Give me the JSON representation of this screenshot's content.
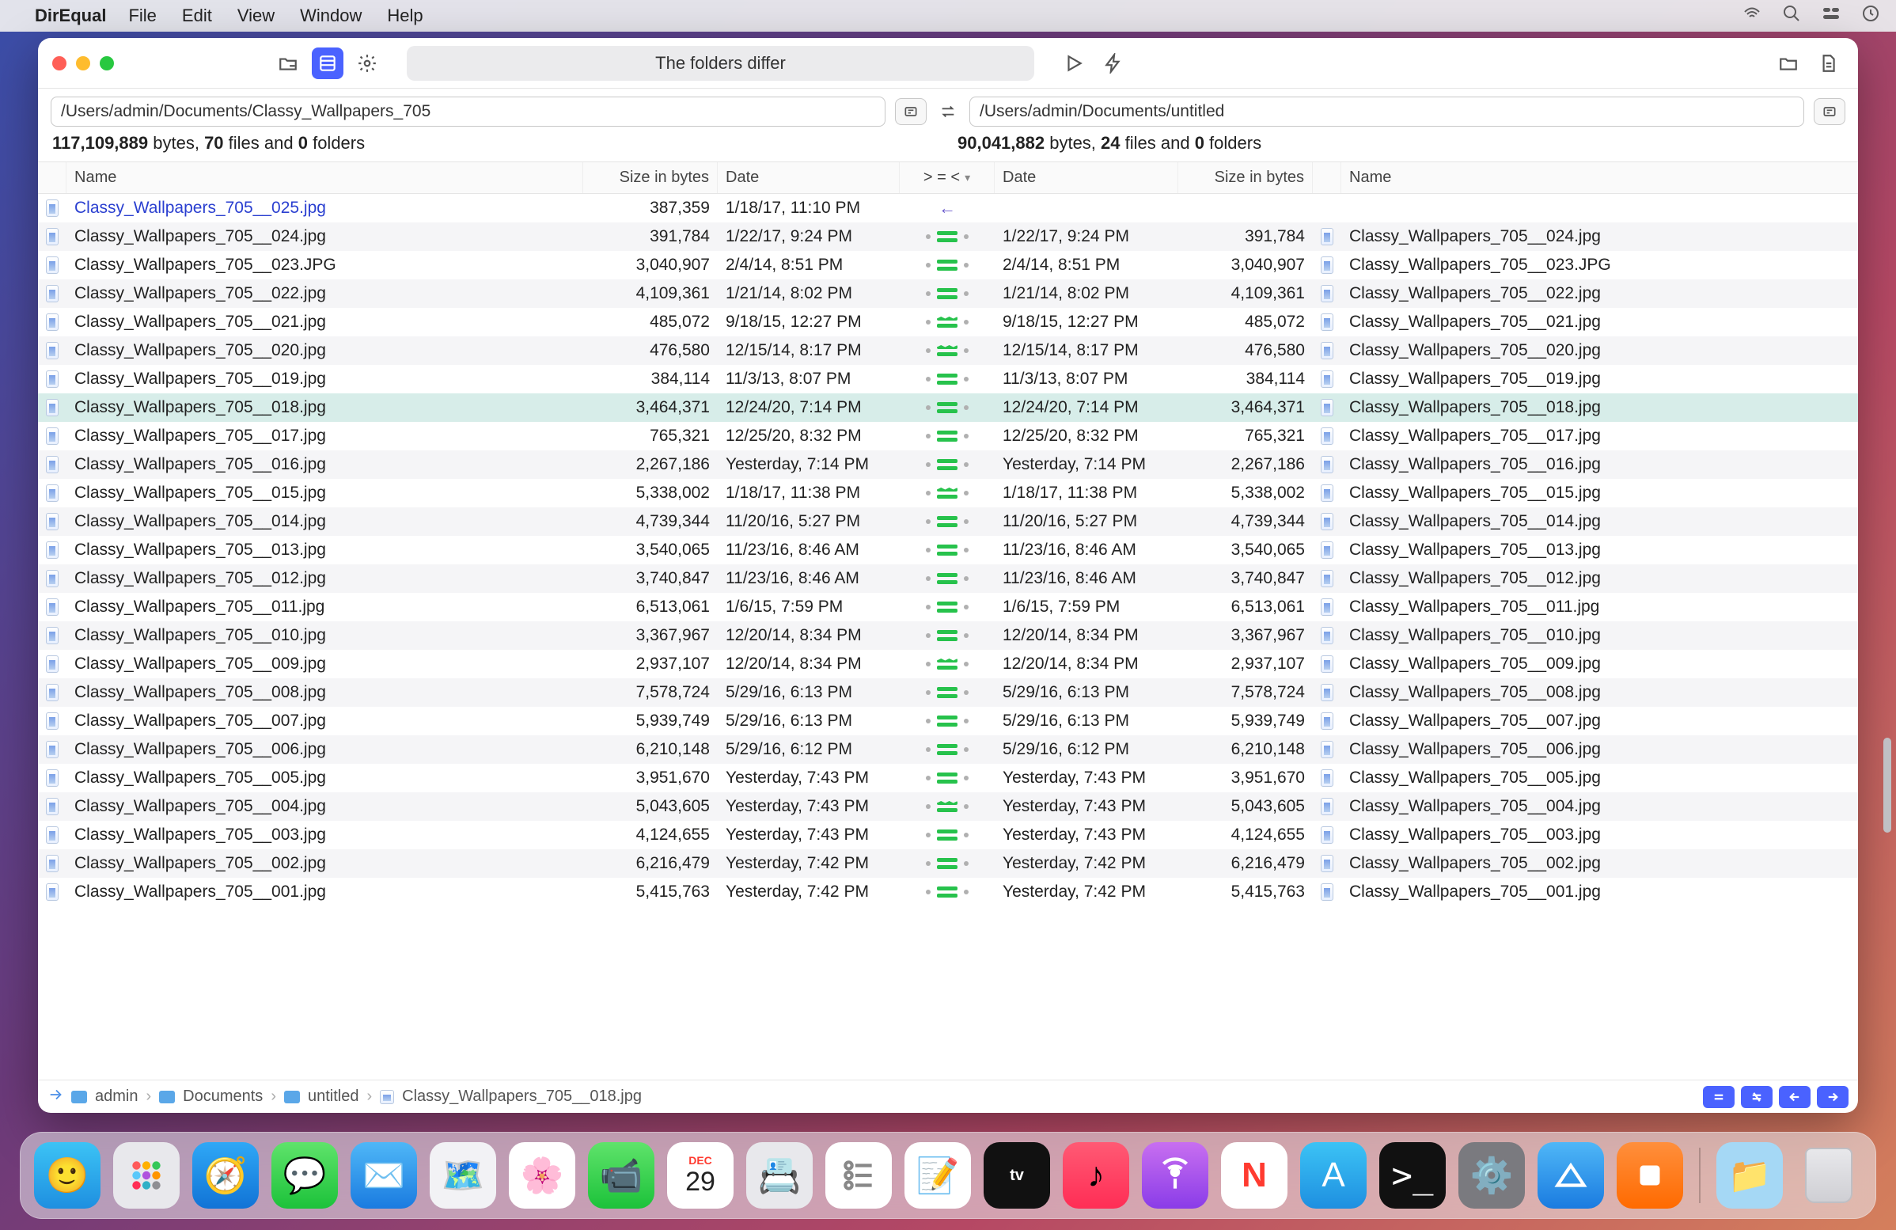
{
  "menubar": {
    "app": "DirEqual",
    "items": [
      "File",
      "Edit",
      "View",
      "Window",
      "Help"
    ]
  },
  "toolbar": {
    "status": "The folders differ"
  },
  "left": {
    "path": "/Users/admin/Documents/Classy_Wallpapers_705",
    "stats_bytes": "117,109,889",
    "stats_files": "70",
    "stats_folders": "0"
  },
  "right": {
    "path": "/Users/admin/Documents/untitled",
    "stats_bytes": "90,041,882",
    "stats_files": "24",
    "stats_folders": "0"
  },
  "headers": {
    "name": "Name",
    "size": "Size in bytes",
    "date": "Date",
    "cmp": "> = <"
  },
  "rows": [
    {
      "ln": "Classy_Wallpapers_705__025.jpg",
      "ls": "387,359",
      "ld": "1/18/17, 11:10 PM",
      "c": "left-only",
      "rd": "",
      "rs": "",
      "rn": ""
    },
    {
      "ln": "Classy_Wallpapers_705__024.jpg",
      "ls": "391,784",
      "ld": "1/22/17, 9:24 PM",
      "c": "eq",
      "rd": "1/22/17, 9:24 PM",
      "rs": "391,784",
      "rn": "Classy_Wallpapers_705__024.jpg"
    },
    {
      "ln": "Classy_Wallpapers_705__023.JPG",
      "ls": "3,040,907",
      "ld": "2/4/14, 8:51 PM",
      "c": "eq",
      "rd": "2/4/14, 8:51 PM",
      "rs": "3,040,907",
      "rn": "Classy_Wallpapers_705__023.JPG"
    },
    {
      "ln": "Classy_Wallpapers_705__022.jpg",
      "ls": "4,109,361",
      "ld": "1/21/14, 8:02 PM",
      "c": "eq",
      "rd": "1/21/14, 8:02 PM",
      "rs": "4,109,361",
      "rn": "Classy_Wallpapers_705__022.jpg"
    },
    {
      "ln": "Classy_Wallpapers_705__021.jpg",
      "ls": "485,072",
      "ld": "9/18/15, 12:27 PM",
      "c": "neq",
      "rd": "9/18/15, 12:27 PM",
      "rs": "485,072",
      "rn": "Classy_Wallpapers_705__021.jpg"
    },
    {
      "ln": "Classy_Wallpapers_705__020.jpg",
      "ls": "476,580",
      "ld": "12/15/14, 8:17 PM",
      "c": "neq",
      "rd": "12/15/14, 8:17 PM",
      "rs": "476,580",
      "rn": "Classy_Wallpapers_705__020.jpg"
    },
    {
      "ln": "Classy_Wallpapers_705__019.jpg",
      "ls": "384,114",
      "ld": "11/3/13, 8:07 PM",
      "c": "eq",
      "rd": "11/3/13, 8:07 PM",
      "rs": "384,114",
      "rn": "Classy_Wallpapers_705__019.jpg"
    },
    {
      "ln": "Classy_Wallpapers_705__018.jpg",
      "ls": "3,464,371",
      "ld": "12/24/20, 7:14 PM",
      "c": "eq",
      "rd": "12/24/20, 7:14 PM",
      "rs": "3,464,371",
      "rn": "Classy_Wallpapers_705__018.jpg",
      "sel": true
    },
    {
      "ln": "Classy_Wallpapers_705__017.jpg",
      "ls": "765,321",
      "ld": "12/25/20, 8:32 PM",
      "c": "eq",
      "rd": "12/25/20, 8:32 PM",
      "rs": "765,321",
      "rn": "Classy_Wallpapers_705__017.jpg"
    },
    {
      "ln": "Classy_Wallpapers_705__016.jpg",
      "ls": "2,267,186",
      "ld": "Yesterday, 7:14 PM",
      "c": "eq",
      "rd": "Yesterday, 7:14 PM",
      "rs": "2,267,186",
      "rn": "Classy_Wallpapers_705__016.jpg"
    },
    {
      "ln": "Classy_Wallpapers_705__015.jpg",
      "ls": "5,338,002",
      "ld": "1/18/17, 11:38 PM",
      "c": "neq",
      "rd": "1/18/17, 11:38 PM",
      "rs": "5,338,002",
      "rn": "Classy_Wallpapers_705__015.jpg"
    },
    {
      "ln": "Classy_Wallpapers_705__014.jpg",
      "ls": "4,739,344",
      "ld": "11/20/16, 5:27 PM",
      "c": "eq",
      "rd": "11/20/16, 5:27 PM",
      "rs": "4,739,344",
      "rn": "Classy_Wallpapers_705__014.jpg"
    },
    {
      "ln": "Classy_Wallpapers_705__013.jpg",
      "ls": "3,540,065",
      "ld": "11/23/16, 8:46 AM",
      "c": "eq",
      "rd": "11/23/16, 8:46 AM",
      "rs": "3,540,065",
      "rn": "Classy_Wallpapers_705__013.jpg"
    },
    {
      "ln": "Classy_Wallpapers_705__012.jpg",
      "ls": "3,740,847",
      "ld": "11/23/16, 8:46 AM",
      "c": "eq",
      "rd": "11/23/16, 8:46 AM",
      "rs": "3,740,847",
      "rn": "Classy_Wallpapers_705__012.jpg"
    },
    {
      "ln": "Classy_Wallpapers_705__011.jpg",
      "ls": "6,513,061",
      "ld": "1/6/15, 7:59 PM",
      "c": "eq",
      "rd": "1/6/15, 7:59 PM",
      "rs": "6,513,061",
      "rn": "Classy_Wallpapers_705__011.jpg"
    },
    {
      "ln": "Classy_Wallpapers_705__010.jpg",
      "ls": "3,367,967",
      "ld": "12/20/14, 8:34 PM",
      "c": "eq",
      "rd": "12/20/14, 8:34 PM",
      "rs": "3,367,967",
      "rn": "Classy_Wallpapers_705__010.jpg"
    },
    {
      "ln": "Classy_Wallpapers_705__009.jpg",
      "ls": "2,937,107",
      "ld": "12/20/14, 8:34 PM",
      "c": "neq",
      "rd": "12/20/14, 8:34 PM",
      "rs": "2,937,107",
      "rn": "Classy_Wallpapers_705__009.jpg"
    },
    {
      "ln": "Classy_Wallpapers_705__008.jpg",
      "ls": "7,578,724",
      "ld": "5/29/16, 6:13 PM",
      "c": "eq",
      "rd": "5/29/16, 6:13 PM",
      "rs": "7,578,724",
      "rn": "Classy_Wallpapers_705__008.jpg"
    },
    {
      "ln": "Classy_Wallpapers_705__007.jpg",
      "ls": "5,939,749",
      "ld": "5/29/16, 6:13 PM",
      "c": "eq",
      "rd": "5/29/16, 6:13 PM",
      "rs": "5,939,749",
      "rn": "Classy_Wallpapers_705__007.jpg"
    },
    {
      "ln": "Classy_Wallpapers_705__006.jpg",
      "ls": "6,210,148",
      "ld": "5/29/16, 6:12 PM",
      "c": "eq",
      "rd": "5/29/16, 6:12 PM",
      "rs": "6,210,148",
      "rn": "Classy_Wallpapers_705__006.jpg"
    },
    {
      "ln": "Classy_Wallpapers_705__005.jpg",
      "ls": "3,951,670",
      "ld": "Yesterday, 7:43 PM",
      "c": "eq",
      "rd": "Yesterday, 7:43 PM",
      "rs": "3,951,670",
      "rn": "Classy_Wallpapers_705__005.jpg"
    },
    {
      "ln": "Classy_Wallpapers_705__004.jpg",
      "ls": "5,043,605",
      "ld": "Yesterday, 7:43 PM",
      "c": "neq",
      "rd": "Yesterday, 7:43 PM",
      "rs": "5,043,605",
      "rn": "Classy_Wallpapers_705__004.jpg"
    },
    {
      "ln": "Classy_Wallpapers_705__003.jpg",
      "ls": "4,124,655",
      "ld": "Yesterday, 7:43 PM",
      "c": "eq",
      "rd": "Yesterday, 7:43 PM",
      "rs": "4,124,655",
      "rn": "Classy_Wallpapers_705__003.jpg"
    },
    {
      "ln": "Classy_Wallpapers_705__002.jpg",
      "ls": "6,216,479",
      "ld": "Yesterday, 7:42 PM",
      "c": "eq",
      "rd": "Yesterday, 7:42 PM",
      "rs": "6,216,479",
      "rn": "Classy_Wallpapers_705__002.jpg"
    },
    {
      "ln": "Classy_Wallpapers_705__001.jpg",
      "ls": "5,415,763",
      "ld": "Yesterday, 7:42 PM",
      "c": "eq",
      "rd": "Yesterday, 7:42 PM",
      "rs": "5,415,763",
      "rn": "Classy_Wallpapers_705__001.jpg"
    }
  ],
  "breadcrumb": [
    "admin",
    "Documents",
    "untitled",
    "Classy_Wallpapers_705__018.jpg"
  ],
  "calendar": {
    "month": "DEC",
    "day": "29"
  },
  "stats_labels": {
    "bytes": " bytes, ",
    "files": " files and ",
    "folders": " folders"
  }
}
